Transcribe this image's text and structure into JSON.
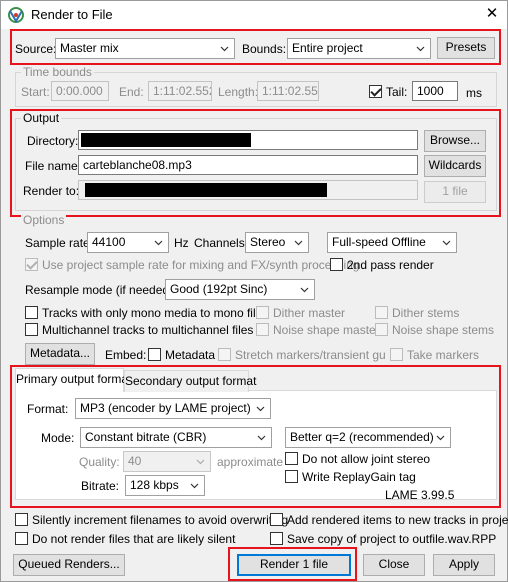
{
  "window": {
    "title": "Render to File",
    "close": "✕"
  },
  "top": {
    "source_label": "Source:",
    "source_value": "Master mix",
    "bounds_label": "Bounds:",
    "bounds_value": "Entire project",
    "presets": "Presets"
  },
  "time_bounds": {
    "title": "Time bounds",
    "start_label": "Start:",
    "start_value": "0:00.000",
    "end_label": "End:",
    "end_value": "1:11:02.552",
    "length_label": "Length:",
    "length_value": "1:11:02.552",
    "tail_label": "Tail:",
    "tail_value": "1000",
    "tail_unit": "ms"
  },
  "output": {
    "title": "Output",
    "directory_label": "Directory:",
    "browse": "Browse...",
    "filename_label": "File name:",
    "filename_value": "carteblanche08.mp3",
    "wildcards": "Wildcards",
    "render_to_label": "Render to:",
    "files_button": "1 file"
  },
  "options": {
    "title": "Options",
    "sample_rate_label": "Sample rate:",
    "sample_rate_value": "44100",
    "hz": "Hz",
    "channels_label": "Channels:",
    "channels_value": "Stereo",
    "speed_value": "Full-speed Offline",
    "use_project_rate": "Use project sample rate for mixing and FX/synth processing",
    "second_pass": "2nd pass render",
    "resample_label": "Resample mode (if needed):",
    "resample_value": "Good (192pt Sinc)",
    "mono_tracks": "Tracks with only mono media to mono file",
    "dither_master": "Dither master",
    "dither_stems": "Dither stems",
    "multichannel": "Multichannel tracks to multichannel files",
    "noise_master": "Noise shape master",
    "noise_stems": "Noise shape stems",
    "metadata_button": "Metadata...",
    "embed_label": "Embed:",
    "embed_metadata": "Metadata",
    "stretch_markers": "Stretch markers/transient guides",
    "take_markers": "Take markers"
  },
  "format": {
    "tab_primary": "Primary output format",
    "tab_secondary": "Secondary output format",
    "format_label": "Format:",
    "format_value": "MP3 (encoder by LAME project)",
    "mode_label": "Mode:",
    "mode_value": "Constant bitrate  (CBR)",
    "quality_preset": "Better q=2 (recommended)",
    "quality_label": "Quality:",
    "quality_value": "40",
    "approximate": "approximate",
    "no_joint_stereo": "Do not allow joint stereo",
    "replaygain": "Write ReplayGain tag",
    "bitrate_label": "Bitrate:",
    "bitrate_value": "128 kbps",
    "lame_version": "LAME 3.99.5"
  },
  "bottom": {
    "silent_increment": "Silently increment filenames to avoid overwriting",
    "add_rendered": "Add rendered items to new tracks in project",
    "no_render_silent": "Do not render files that are likely silent",
    "save_copy": "Save copy of project to outfile.wav.RPP",
    "queued": "Queued Renders...",
    "render": "Render 1 file",
    "close": "Close",
    "apply": "Apply"
  },
  "colors": {
    "highlight": "#e8141d",
    "accent": "#0078d7"
  }
}
